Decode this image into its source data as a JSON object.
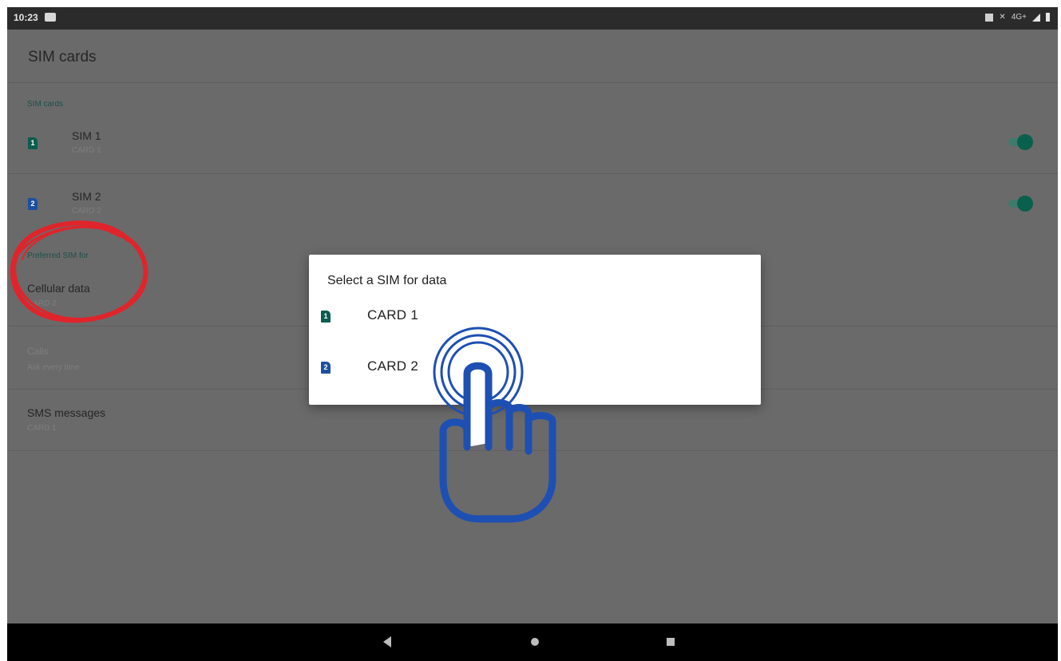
{
  "status_bar": {
    "time": "10:23",
    "right_text": "4G+"
  },
  "app_bar": {
    "title": "SIM cards"
  },
  "sections": {
    "sim_cards_label": "SIM cards",
    "preferred_label": "Preferred SIM for"
  },
  "sims": [
    {
      "icon_number": "1",
      "title": "SIM 1",
      "subtitle": "CARD 1",
      "enabled": true
    },
    {
      "icon_number": "2",
      "title": "SIM 2",
      "subtitle": "CARD 2",
      "enabled": true
    }
  ],
  "preferred": {
    "cellular_data": {
      "title": "Cellular data",
      "value": "CARD 2"
    },
    "calls": {
      "title": "Calls",
      "value": "Ask every time"
    },
    "sms": {
      "title": "SMS messages",
      "value": "CARD 1"
    }
  },
  "dialog": {
    "title": "Select a SIM for data",
    "options": [
      {
        "icon_number": "1",
        "label": "CARD 1"
      },
      {
        "icon_number": "2",
        "label": "CARD 2"
      }
    ]
  },
  "colors": {
    "sim1_icon": "#0d5d4e",
    "sim2_icon": "#1c4fa0",
    "toggle_on": "#0b5f4d",
    "annotation_circle": "#e0242b",
    "hand_cursor": "#1e4fb3"
  },
  "icons": {
    "status_left": "gallery-icon",
    "status_right": [
      "screenshot-icon",
      "mute-icon",
      "signal-icon",
      "battery-icon"
    ],
    "nav": [
      "back-icon",
      "home-icon",
      "recents-icon"
    ],
    "overlay": "tap-hand-icon"
  }
}
